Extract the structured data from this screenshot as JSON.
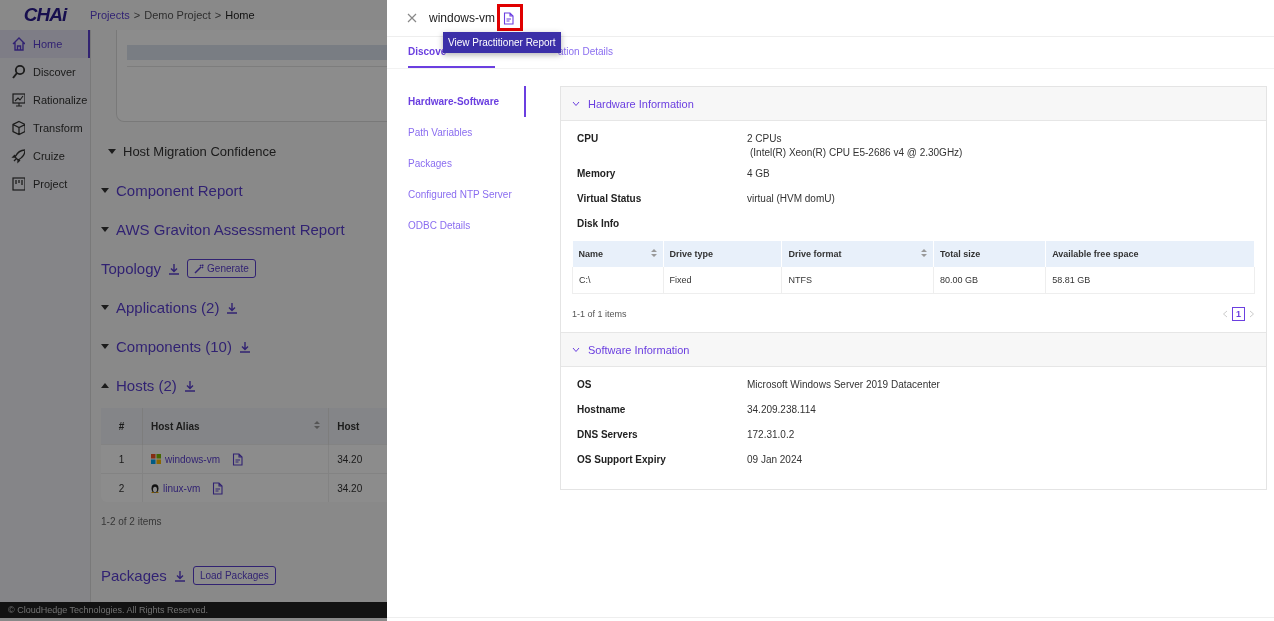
{
  "logo": "CHAi",
  "breadcrumb": {
    "items": [
      "Projects",
      "Demo Project",
      "Home"
    ],
    "separator": ">"
  },
  "sidebar": {
    "items": [
      {
        "label": "Home",
        "selected": true
      },
      {
        "label": "Discover",
        "selected": false
      },
      {
        "label": "Rationalize",
        "selected": false
      },
      {
        "label": "Transform",
        "selected": false
      },
      {
        "label": "Cruize",
        "selected": false
      },
      {
        "label": "Project",
        "selected": false
      }
    ]
  },
  "sections": [
    {
      "kind": "plain",
      "title": "Host Migration Confidence",
      "expanded": false
    },
    {
      "kind": "link",
      "title": "Component Report",
      "expanded": false
    },
    {
      "kind": "link",
      "title": "AWS Graviton Assessment Report",
      "expanded": false
    },
    {
      "kind": "action",
      "title": "Topology",
      "download": true,
      "button": "Generate"
    },
    {
      "kind": "link",
      "title": "Applications (2)",
      "expanded": false,
      "download": true
    },
    {
      "kind": "link",
      "title": "Components (10)",
      "expanded": false,
      "download": true
    },
    {
      "kind": "link",
      "title": "Hosts (2)",
      "expanded": true,
      "download": true
    }
  ],
  "hosts_table": {
    "columns": [
      {
        "label": "#",
        "sortable": false
      },
      {
        "label": "Host Alias",
        "sortable": true
      },
      {
        "label": "Host",
        "sortable": false
      }
    ],
    "rows": [
      {
        "number": "1",
        "alias": "windows-vm",
        "kind": "windows",
        "host": "34.20"
      },
      {
        "number": "2",
        "alias": "linux-vm",
        "kind": "linux",
        "host": "34.20"
      }
    ],
    "summary": "1-2 of 2 items"
  },
  "packages": {
    "title": "Packages",
    "download": true,
    "button": "Load Packages"
  },
  "footer": "© CloudHedge Technologies. All Rights Reserved.",
  "drawer": {
    "title": "windows-vm",
    "report_highlighted": true,
    "tooltip": "View Practitioner Report",
    "tabs": [
      {
        "label": "Discove",
        "selected": true
      },
      {
        "label": "ation Details",
        "selected": false
      }
    ],
    "nav": [
      {
        "label": "Hardware-Software",
        "selected": true
      },
      {
        "label": "Path Variables",
        "selected": false
      },
      {
        "label": "Packages",
        "selected": false
      },
      {
        "label": "Configured NTP Server",
        "selected": false
      },
      {
        "label": "ODBC Details",
        "selected": false
      }
    ],
    "hardware": {
      "title": "Hardware Information",
      "expanded": true,
      "fields": [
        {
          "label": "CPU",
          "value": [
            "2 CPUs",
            "(Intel(R) Xeon(R) CPU E5-2686 v4 @ 2.30GHz)"
          ]
        },
        {
          "label": "Memory",
          "value": [
            "4 GB"
          ]
        },
        {
          "label": "Virtual Status",
          "value": [
            "virtual (HVM domU)"
          ]
        },
        {
          "label": "Disk Info"
        }
      ],
      "disk_table": {
        "columns": [
          {
            "label": "Name",
            "sortable": true
          },
          {
            "label": "Drive type",
            "sortable": false
          },
          {
            "label": "Drive format",
            "sortable": true
          },
          {
            "label": "Total size",
            "sortable": false
          },
          {
            "label": "Available free space",
            "sortable": false
          }
        ],
        "rows": [
          [
            "C:\\",
            "Fixed",
            "NTFS",
            "80.00 GB",
            "58.81 GB"
          ]
        ]
      },
      "summary": "1-1 of 1 items",
      "pages": [
        {
          "label": "1",
          "selected": true
        }
      ]
    },
    "software": {
      "title": "Software Information",
      "expanded": true,
      "fields": [
        {
          "label": "OS",
          "value": [
            "Microsoft Windows Server 2019 Datacenter"
          ]
        },
        {
          "label": "Hostname",
          "value": [
            "34.209.238.114"
          ]
        },
        {
          "label": "DNS Servers",
          "value": [
            "172.31.0.2"
          ]
        },
        {
          "label": "OS Support Expiry",
          "value": [
            "09 Jan 2024"
          ]
        }
      ]
    }
  }
}
